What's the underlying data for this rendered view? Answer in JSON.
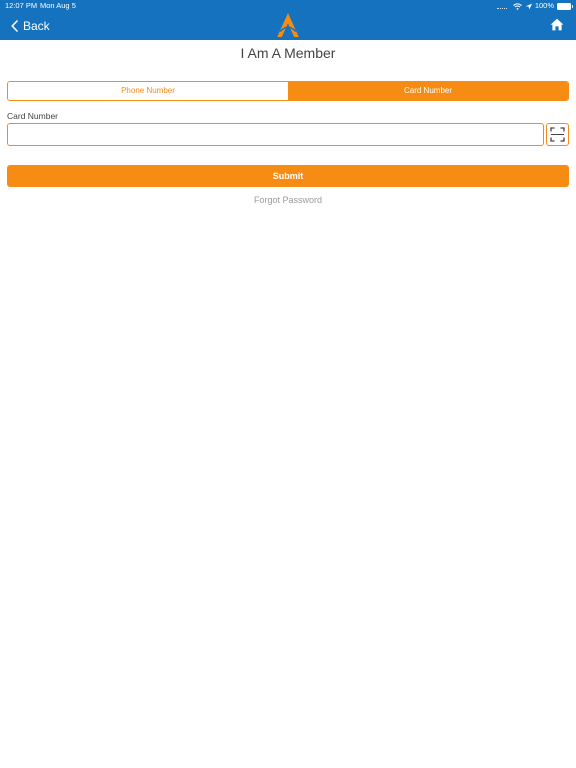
{
  "status_bar": {
    "time": "12:07 PM",
    "date": "Mon Aug 5",
    "battery": "100%"
  },
  "nav": {
    "back_label": "Back",
    "logo_icon": "brand-logo-icon",
    "home_icon": "home-icon"
  },
  "page": {
    "title": "I Am A Member"
  },
  "segmented_control": {
    "options": [
      "Phone Number",
      "Card Number"
    ],
    "selected": "Card Number"
  },
  "form": {
    "card_label": "Card Number",
    "card_value": "",
    "scan_icon": "scan-icon",
    "submit_label": "Submit",
    "forgot_label": "Forgot Password"
  },
  "colors": {
    "nav_blue": "#1572bf",
    "accent_orange": "#f78c15",
    "text_dark": "#444444",
    "text_muted": "#9b9b9b"
  }
}
